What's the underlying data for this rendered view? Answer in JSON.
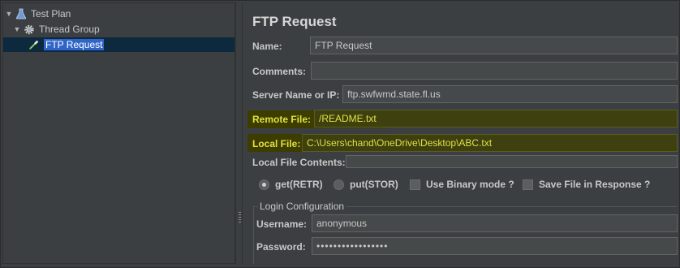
{
  "tree": {
    "items": [
      {
        "label": "Test Plan",
        "icon": "flask-icon"
      },
      {
        "label": "Thread Group",
        "icon": "gear-icon"
      },
      {
        "label": "FTP Request",
        "icon": "pipette-icon"
      }
    ]
  },
  "form": {
    "title": "FTP Request",
    "name_label": "Name:",
    "name_value": "FTP Request",
    "comments_label": "Comments:",
    "comments_value": "",
    "server_label": "Server Name or IP:",
    "server_value": "ftp.swfwmd.state.fl.us",
    "remote_label": "Remote File:",
    "remote_value": "/README.txt",
    "local_label": "Local File:",
    "local_value": "C:\\Users\\chand\\OneDrive\\Desktop\\ABC.txt",
    "local_contents_label": "Local File Contents:",
    "options": {
      "get_label": "get(RETR)",
      "put_label": "put(STOR)",
      "binary_label": "Use Binary mode ?",
      "save_label": "Save File in Response ?",
      "selected_mode": "get(RETR)",
      "binary_checked": false,
      "save_checked": false
    },
    "login": {
      "legend": "Login Configuration",
      "username_label": "Username:",
      "username_value": "anonymous",
      "password_label": "Password:",
      "password_value": "•••••••••••••••••"
    }
  },
  "colors": {
    "highlight_text": "#e0e040",
    "selection": "#2f65ca"
  }
}
